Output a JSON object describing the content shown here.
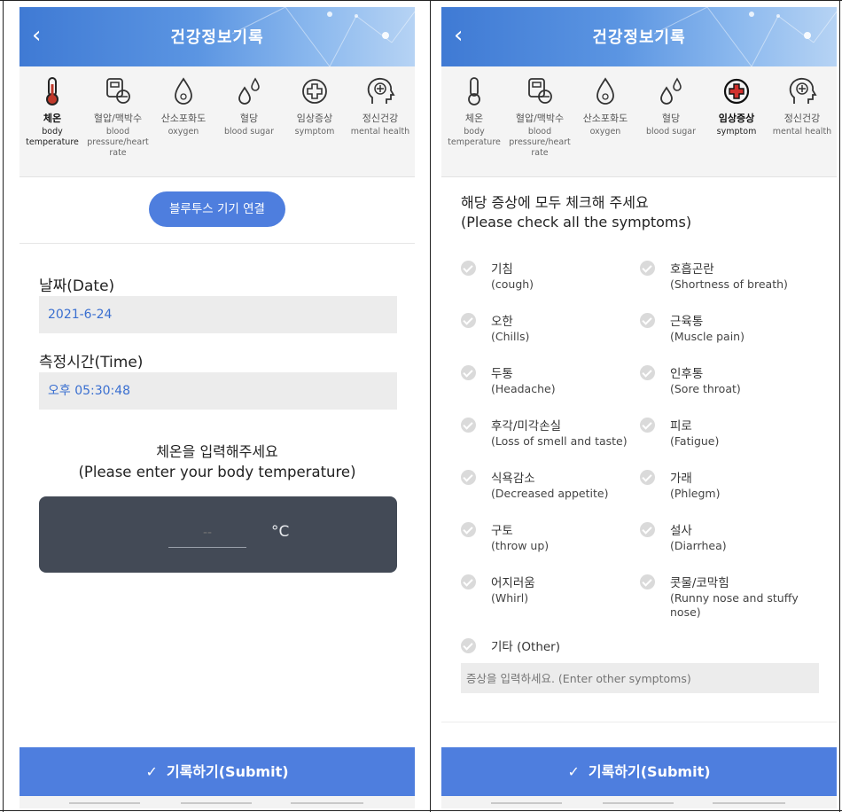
{
  "header": {
    "back_icon": "chevron-left-icon",
    "title": "건강정보기록"
  },
  "categories": [
    {
      "key": "temperature",
      "ko": "체온",
      "en": "body temperature",
      "icon": "thermometer-icon"
    },
    {
      "key": "bp",
      "ko": "혈압/맥박수",
      "en": "blood pressure/heart rate",
      "icon": "blood-pressure-icon"
    },
    {
      "key": "oxygen",
      "ko": "산소포화도",
      "en": "oxygen",
      "icon": "oxygen-drop-icon"
    },
    {
      "key": "sugar",
      "ko": "혈당",
      "en": "blood sugar",
      "icon": "blood-drops-icon"
    },
    {
      "key": "symptom",
      "ko": "임상증상",
      "en": "symptom",
      "icon": "medical-cross-icon"
    },
    {
      "key": "mental",
      "ko": "정신건강",
      "en": "mental health",
      "icon": "head-plus-icon"
    }
  ],
  "left": {
    "active_category": "체온",
    "bluetooth_button": "블루투스 기기 연결",
    "date_label": "날짜(Date)",
    "date_value": "2021-6-24",
    "time_label": "측정시간(Time)",
    "time_value": "오후 05:30:48",
    "prompt_ko": "체온을 입력해주세요",
    "prompt_en": "(Please enter your body temperature)",
    "temp_placeholder": "--",
    "temp_unit": "°C",
    "submit_label": "기록하기(Submit)"
  },
  "right": {
    "active_category": "임상증상",
    "title_ko": "해당 증상에 모두 체크해 주세요",
    "title_en": "(Please check all the symptoms)",
    "symptoms": [
      {
        "ko": "기침",
        "en": "(cough)"
      },
      {
        "ko": "호흡곤란",
        "en": "(Shortness of breath)"
      },
      {
        "ko": "오한",
        "en": "(Chills)"
      },
      {
        "ko": "근육통",
        "en": "(Muscle pain)"
      },
      {
        "ko": "두통",
        "en": "(Headache)"
      },
      {
        "ko": "인후통",
        "en": "(Sore throat)"
      },
      {
        "ko": "후각/미각손실",
        "en": "(Loss of smell and taste)"
      },
      {
        "ko": "피로",
        "en": "(Fatigue)"
      },
      {
        "ko": "식욕감소",
        "en": "(Decreased appetite)"
      },
      {
        "ko": "가래",
        "en": "(Phlegm)"
      },
      {
        "ko": "구토",
        "en": "(throw up)"
      },
      {
        "ko": "설사",
        "en": "(Diarrhea)"
      },
      {
        "ko": "어지러움",
        "en": "(Whirl)"
      },
      {
        "ko": "콧물/코막힘",
        "en": "(Runny nose and stuffy nose)"
      }
    ],
    "other_label": "기타 (Other)",
    "other_placeholder": "증상을 입력하세요. (Enter other symptoms)",
    "submit_label": "기록하기(Submit)"
  },
  "colors": {
    "accent": "#4e7ede",
    "header_start": "#3f7ad4",
    "header_end": "#b6d3f4",
    "temp_panel": "#434a56",
    "field_bg": "#ececec",
    "field_text": "#3a6fd0",
    "thermometer": "#c0392b",
    "cross": "#d0312d"
  }
}
